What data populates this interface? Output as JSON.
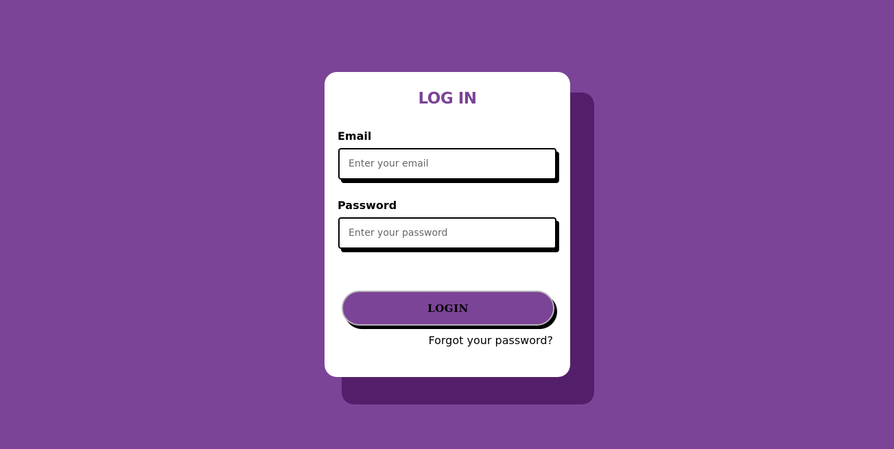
{
  "login_card": {
    "title": "LOG IN",
    "email": {
      "label": "Email",
      "value": "",
      "placeholder": "Enter your email"
    },
    "password": {
      "label": "Password",
      "value": "",
      "placeholder": "Enter your password"
    },
    "login_button_label": "LOGIN",
    "forgot_password_link": "Forgot your password?"
  },
  "colors": {
    "background": "#7b4497",
    "card_shadow": "#541f6a",
    "accent": "#7b4497",
    "card": "#ffffff"
  }
}
